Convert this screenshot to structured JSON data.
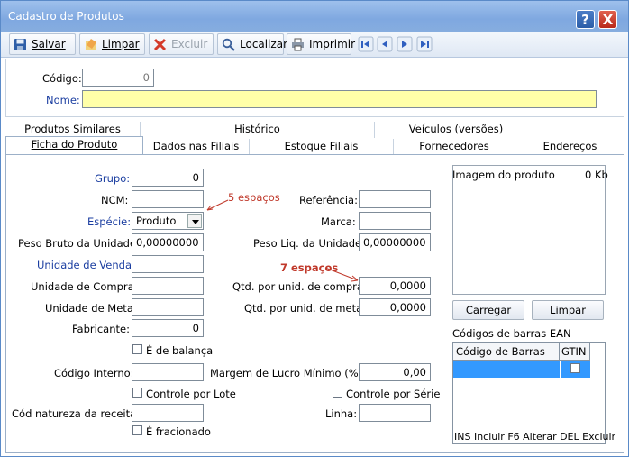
{
  "window": {
    "title": "Cadastro de Produtos",
    "help_label": "?",
    "close_label": "X"
  },
  "toolbar": {
    "save": "Salvar",
    "clear": "Limpar",
    "delete": "Excluir",
    "find": "Localizar",
    "print": "Imprimir",
    "nav_icons": [
      "first-record-icon",
      "prev-record-icon",
      "next-record-icon",
      "last-record-icon"
    ]
  },
  "header": {
    "codigo_label": "Código:",
    "codigo_value": "0",
    "nome_label": "Nome:",
    "nome_value": ""
  },
  "tabs_row1": [
    "Produtos Similares",
    "Histórico",
    "Veículos (versões)"
  ],
  "tabs_row2": [
    "Ficha do Produto",
    "Dados nas Filiais",
    "Estoque Filiais",
    "Fornecedores",
    "Endereços"
  ],
  "form": {
    "grupo_label": "Grupo:",
    "grupo_value": "0",
    "ncm_label": "NCM:",
    "ncm_value": "",
    "especie_label": "Espécie:",
    "especie_value": "Produto",
    "peso_bruto_label": "Peso Bruto da Unidade:",
    "peso_bruto_value": "0,00000000",
    "unidade_venda_label": "Unidade de Venda:",
    "unidade_venda_value": "",
    "unidade_compra_label": "Unidade de Compra:",
    "unidade_compra_value": "",
    "unidade_meta_label": "Unidade de Meta:",
    "unidade_meta_value": "",
    "fabricante_label": "Fabricante:",
    "fabricante_value": "0",
    "balanca_label": "É de balança",
    "codigo_interno_label": "Código Interno:",
    "codigo_interno_value": "",
    "controle_lote_label": "Controle por Lote",
    "natureza_label": "Cód natureza da receita:",
    "natureza_value": "",
    "fracionado_label": "É fracionado",
    "referencia_label": "Referência:",
    "referencia_value": "",
    "marca_label": "Marca:",
    "marca_value": "",
    "peso_liq_label": "Peso Liq. da Unidade:",
    "peso_liq_value": "0,00000000",
    "qtd_compra_label": "Qtd. por unid. de compra:",
    "qtd_compra_value": "0,0000",
    "qtd_meta_label": "Qtd. por unid. de meta:",
    "qtd_meta_value": "0,0000",
    "margem_label": "Margem de Lucro Mínimo (%):",
    "margem_value": "0,00",
    "controle_serie_label": "Controle por Série",
    "linha_label": "Linha:",
    "linha_value": ""
  },
  "annotations": {
    "note1": "5 espaços",
    "note2": "7 espaços"
  },
  "image_panel": {
    "title": "Imagem do produto",
    "size": "0 Kb",
    "load_button": "Carregar",
    "clear_button": "Limpar"
  },
  "barcodes": {
    "title": "Códigos de barras EAN",
    "col_code": "Código de Barras",
    "col_gtin": "GTIN",
    "footer": "INS Incluir F6 Alterar DEL Excluir"
  }
}
